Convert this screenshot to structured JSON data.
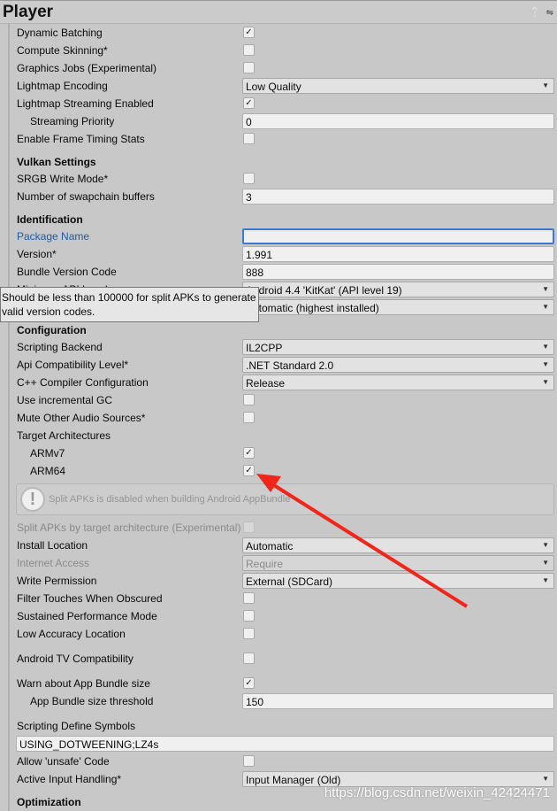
{
  "title": "Player",
  "title_icons": [
    "help-icon",
    "settings-sliders-icon"
  ],
  "rows": [
    {
      "type": "check",
      "label": "Dynamic Batching",
      "checked": true
    },
    {
      "type": "check",
      "label": "Compute Skinning*",
      "checked": false
    },
    {
      "type": "check",
      "label": "Graphics Jobs (Experimental)",
      "checked": false
    },
    {
      "type": "dropdown",
      "label": "Lightmap Encoding",
      "value": "Low Quality"
    },
    {
      "type": "check",
      "label": "Lightmap Streaming Enabled",
      "checked": true
    },
    {
      "type": "text",
      "label": "Streaming Priority",
      "value": "0",
      "indent": true
    },
    {
      "type": "check",
      "label": "Enable Frame Timing Stats",
      "checked": false
    },
    {
      "type": "header",
      "label": "Vulkan Settings"
    },
    {
      "type": "check",
      "label": "SRGB Write Mode*",
      "checked": false
    },
    {
      "type": "text",
      "label": "Number of swapchain buffers",
      "value": "3"
    },
    {
      "type": "header",
      "label": "Identification"
    },
    {
      "type": "text",
      "label": "Package Name",
      "value": "",
      "link": true,
      "focus": true
    },
    {
      "type": "text",
      "label": "Version*",
      "value": "1.991"
    },
    {
      "type": "text",
      "label": "Bundle Version Code",
      "value": "888"
    },
    {
      "type": "dropdown",
      "label": "Minimum API Level",
      "value": "Android 4.4 'KitKat' (API level 19)"
    },
    {
      "type": "dropdown",
      "label": "",
      "value": "Automatic (highest installed)"
    },
    {
      "type": "header",
      "label": "Configuration"
    },
    {
      "type": "dropdown",
      "label": "Scripting Backend",
      "value": "IL2CPP"
    },
    {
      "type": "dropdown",
      "label": "Api Compatibility Level*",
      "value": ".NET Standard 2.0"
    },
    {
      "type": "dropdown",
      "label": "C++ Compiler Configuration",
      "value": "Release"
    },
    {
      "type": "check",
      "label": "Use incremental GC",
      "checked": false
    },
    {
      "type": "check",
      "label": "Mute Other Audio Sources*",
      "checked": false
    },
    {
      "type": "label",
      "label": "Target Architectures"
    },
    {
      "type": "check",
      "label": "ARMv7",
      "checked": true,
      "indent": true
    },
    {
      "type": "check",
      "label": "ARM64",
      "checked": true,
      "indent": true
    },
    {
      "type": "help",
      "label": "Split APKs is disabled when building Android AppBundle"
    },
    {
      "type": "check",
      "label": "Split APKs by target architecture (Experimental)",
      "checked": false,
      "disabled": true
    },
    {
      "type": "dropdown",
      "label": "Install Location",
      "value": "Automatic"
    },
    {
      "type": "dropdown",
      "label": "Internet Access",
      "value": "Require",
      "disabled": true
    },
    {
      "type": "dropdown",
      "label": "Write Permission",
      "value": "External (SDCard)"
    },
    {
      "type": "check",
      "label": "Filter Touches When Obscured",
      "checked": false
    },
    {
      "type": "check",
      "label": "Sustained Performance Mode",
      "checked": false
    },
    {
      "type": "check",
      "label": "Low Accuracy Location",
      "checked": false
    },
    {
      "type": "check",
      "label": "Android TV Compatibility",
      "checked": false,
      "space": true
    },
    {
      "type": "check",
      "label": "Warn about App Bundle size",
      "checked": true,
      "space": true
    },
    {
      "type": "text",
      "label": "App Bundle size threshold",
      "value": "150",
      "indent": true
    },
    {
      "type": "label",
      "label": "Scripting Define Symbols",
      "space": true
    },
    {
      "type": "fulltext",
      "value": "USING_DOTWEENING;LZ4s"
    },
    {
      "type": "check",
      "label": "Allow 'unsafe' Code",
      "checked": false
    },
    {
      "type": "dropdown",
      "label": "Active Input Handling*",
      "value": "Input Manager (Old)"
    },
    {
      "type": "header",
      "label": "Optimization"
    }
  ],
  "tooltip": "Should be less than 100000 for split APKs to generate valid version codes.",
  "watermark": "https://blog.csdn.net/weixin_42424471",
  "colors": {
    "background": "#c8c8c8",
    "link": "#1f5ba8",
    "annotation_arrow": "#f0261b"
  }
}
